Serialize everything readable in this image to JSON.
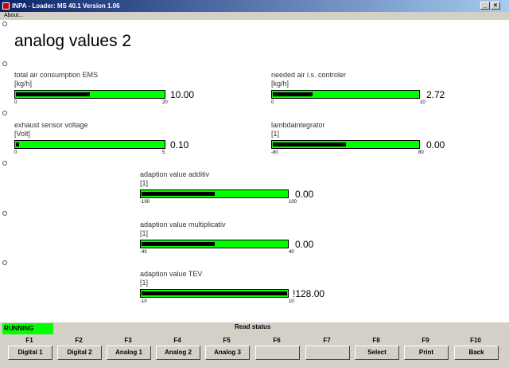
{
  "window": {
    "title": "INPA - Loader: MS 40.1 Version 1.06"
  },
  "menu": {
    "about": "About..."
  },
  "heading": "analog values 2",
  "gauges": [
    {
      "label": "total air consumption EMS",
      "unit": "[kg/h]",
      "value": "10.00",
      "min": "0",
      "max": "20",
      "fill": 0.5
    },
    {
      "label": "needed air i.s. controler",
      "unit": "[kg/h]",
      "value": "2.72",
      "min": "0",
      "max": "10",
      "fill": 0.272
    },
    {
      "label": "exhaust sensor voltage",
      "unit": "[Volt]",
      "value": "0.10",
      "min": "0",
      "max": "5",
      "fill": 0.02
    },
    {
      "label": "lambdaintegrator",
      "unit": "[1]",
      "value": "0.00",
      "min": "-80",
      "max": "80",
      "fill": 0.5
    },
    {
      "label": "adaption value additiv",
      "unit": "[1]",
      "value": "0.00",
      "min": "-100",
      "max": "100",
      "fill": 0.5
    },
    {
      "label": "adaption value multiplicativ",
      "unit": "[1]",
      "value": "0.00",
      "min": "-40",
      "max": "40",
      "fill": 0.5
    },
    {
      "label": "adaption value TEV",
      "unit": "[1]",
      "value": "!128.00",
      "min": "-10",
      "max": "10",
      "fill": 1.0
    }
  ],
  "status": {
    "running": "RUNNING",
    "read_status": "Read status"
  },
  "fkeys": [
    {
      "key": "F1",
      "label": "Digital 1"
    },
    {
      "key": "F2",
      "label": "Digital 2"
    },
    {
      "key": "F3",
      "label": "Analog 1"
    },
    {
      "key": "F4",
      "label": "Analog 2"
    },
    {
      "key": "F5",
      "label": "Analog 3"
    },
    {
      "key": "F6",
      "label": ""
    },
    {
      "key": "F7",
      "label": ""
    },
    {
      "key": "F8",
      "label": "Select"
    },
    {
      "key": "F9",
      "label": "Print"
    },
    {
      "key": "F10",
      "label": "Back"
    }
  ],
  "colors": {
    "bar": "#00ff00",
    "fill": "#000000",
    "title_start": "#0a246a",
    "title_end": "#a6caf0"
  }
}
